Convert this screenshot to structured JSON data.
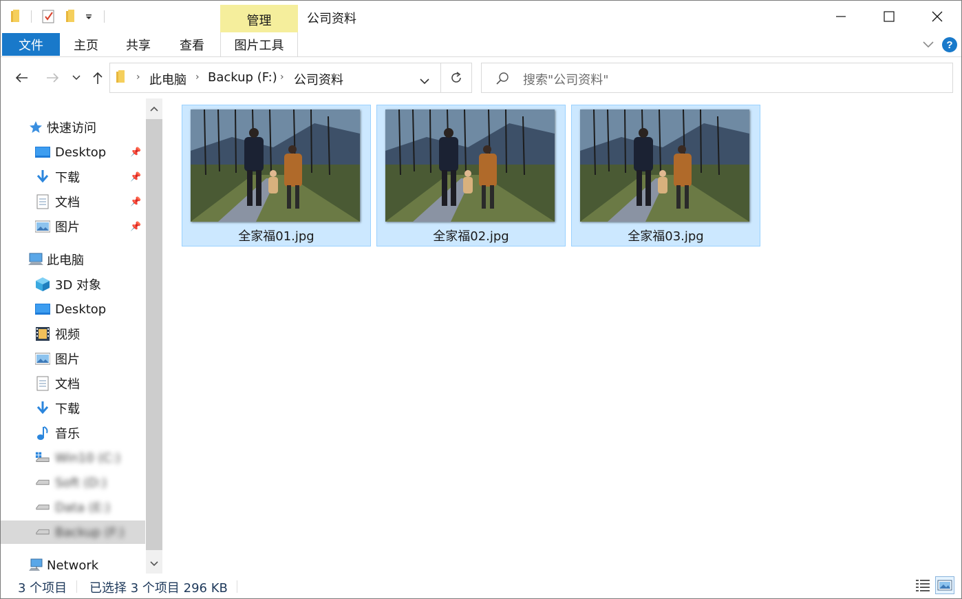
{
  "window": {
    "title": "公司资料",
    "context_tab": "管理"
  },
  "ribbon": {
    "tabs": [
      {
        "label": "文件"
      },
      {
        "label": "主页"
      },
      {
        "label": "共享"
      },
      {
        "label": "查看"
      },
      {
        "label": "图片工具"
      }
    ]
  },
  "address": {
    "crumbs": [
      "此电脑",
      "Backup (F:)",
      "公司资料"
    ]
  },
  "search": {
    "placeholder": "搜索\"公司资料\""
  },
  "sidebar": {
    "quick_access": {
      "label": "快速访问",
      "items": [
        {
          "label": "Desktop",
          "icon": "desktop-icon",
          "pinned": true
        },
        {
          "label": "下载",
          "icon": "download-icon",
          "pinned": true
        },
        {
          "label": "文档",
          "icon": "document-icon",
          "pinned": true
        },
        {
          "label": "图片",
          "icon": "picture-icon",
          "pinned": true
        }
      ]
    },
    "this_pc": {
      "label": "此电脑",
      "items": [
        {
          "label": "3D 对象",
          "icon": "3d-objects-icon"
        },
        {
          "label": "Desktop",
          "icon": "desktop-icon"
        },
        {
          "label": "视频",
          "icon": "video-icon"
        },
        {
          "label": "图片",
          "icon": "picture-icon"
        },
        {
          "label": "文档",
          "icon": "document-icon"
        },
        {
          "label": "下载",
          "icon": "download-icon"
        },
        {
          "label": "音乐",
          "icon": "music-icon"
        }
      ],
      "drives": [
        {
          "label": "Win10 (C:)",
          "icon": "windows-drive-icon",
          "blurred": true
        },
        {
          "label": "Soft (D:)",
          "icon": "drive-icon",
          "blurred": true
        },
        {
          "label": "Data (E:)",
          "icon": "drive-icon",
          "blurred": true
        },
        {
          "label": "Backup (F:)",
          "icon": "drive-icon",
          "blurred": true,
          "selected": true
        }
      ]
    },
    "network": {
      "label": "Network",
      "icon": "network-icon"
    }
  },
  "files": [
    {
      "name": "全家福01.jpg",
      "selected": true
    },
    {
      "name": "全家福02.jpg",
      "selected": true
    },
    {
      "name": "全家福03.jpg",
      "selected": true
    }
  ],
  "status": {
    "count": "3 个项目",
    "selection": "已选择 3 个项目  296 KB"
  },
  "colors": {
    "file_tab": "#1979ca",
    "context_tab": "#f5ee9c",
    "selection_fill": "#cce8ff",
    "selection_border": "#99d1ff"
  }
}
